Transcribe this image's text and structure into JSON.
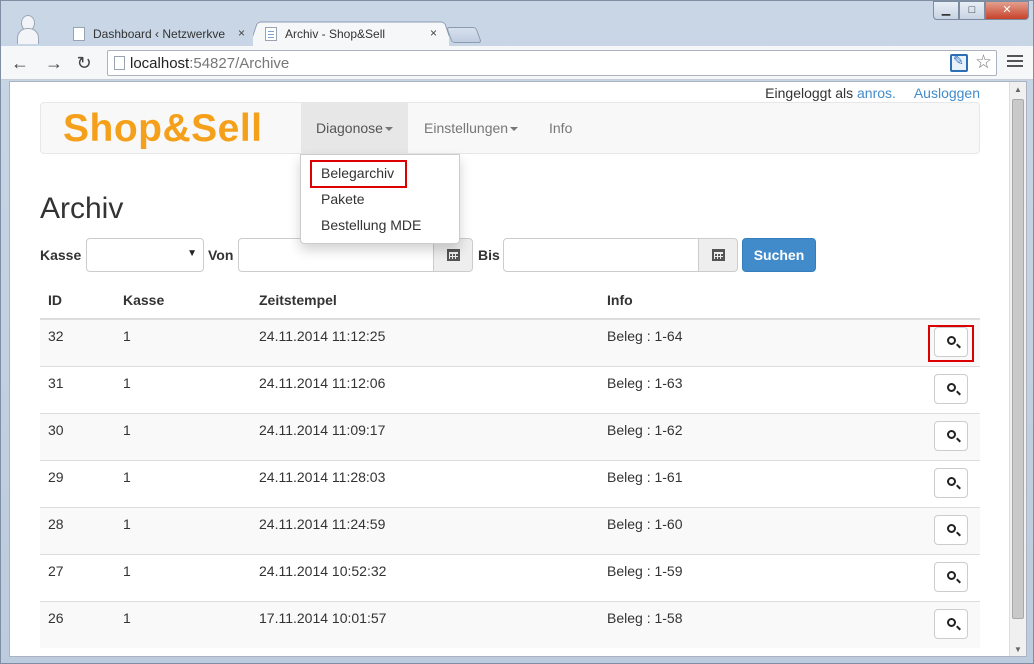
{
  "browser": {
    "tabs": [
      {
        "title": "Dashboard ‹ Netzwerkverw",
        "active": false
      },
      {
        "title": "Archiv - Shop&Sell",
        "active": true
      }
    ],
    "close_glyph": "×",
    "url_host": "localhost",
    "url_path": ":54827/Archive",
    "window_controls": {
      "minimize": "▁",
      "maximize": "□",
      "close": "✕"
    }
  },
  "login": {
    "prefix": "Eingeloggt als",
    "user": "anros.",
    "logout": "Ausloggen"
  },
  "navbar": {
    "brand": "Shop&Sell",
    "brand_color": "#f5a01a",
    "items": [
      {
        "label": "Diagonose",
        "dropdown": true,
        "open": true
      },
      {
        "label": "Einstellungen",
        "dropdown": true,
        "open": false
      },
      {
        "label": "Info",
        "dropdown": false,
        "open": false
      }
    ],
    "dropdown_items": [
      "Belegarchiv",
      "Pakete",
      "Bestellung MDE"
    ]
  },
  "page": {
    "title": "Archiv",
    "filter": {
      "kasse_label": "Kasse",
      "kasse_value": "",
      "von_label": "Von",
      "von_value": "",
      "bis_label": "Bis",
      "bis_value": "",
      "search_button": "Suchen"
    }
  },
  "table": {
    "headers": [
      "ID",
      "Kasse",
      "Zeitstempel",
      "Info",
      ""
    ],
    "rows": [
      {
        "id": "32",
        "kasse": "1",
        "zeit": "24.11.2014 11:12:25",
        "info": "Beleg : 1-64"
      },
      {
        "id": "31",
        "kasse": "1",
        "zeit": "24.11.2014 11:12:06",
        "info": "Beleg : 1-63"
      },
      {
        "id": "30",
        "kasse": "1",
        "zeit": "24.11.2014 11:09:17",
        "info": "Beleg : 1-62"
      },
      {
        "id": "29",
        "kasse": "1",
        "zeit": "24.11.2014 11:28:03",
        "info": "Beleg : 1-61"
      },
      {
        "id": "28",
        "kasse": "1",
        "zeit": "24.11.2014 11:24:59",
        "info": "Beleg : 1-60"
      },
      {
        "id": "27",
        "kasse": "1",
        "zeit": "24.11.2014 10:52:32",
        "info": "Beleg : 1-59"
      },
      {
        "id": "26",
        "kasse": "1",
        "zeit": "17.11.2014 10:01:57",
        "info": "Beleg : 1-58"
      }
    ]
  },
  "colors": {
    "link": "#428bca",
    "primary_button": "#428bca",
    "highlight_annotation": "#dd0000"
  }
}
